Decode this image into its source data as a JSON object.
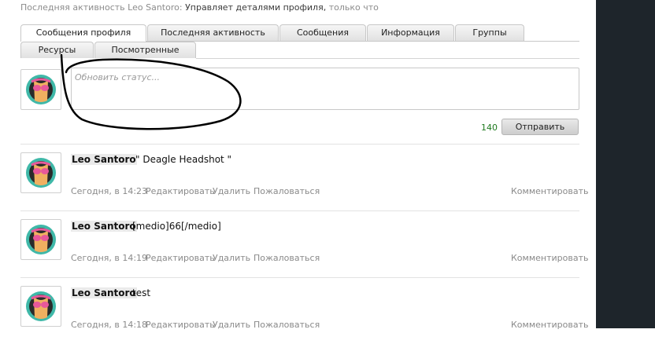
{
  "activity": {
    "prefix": "Последняя активность",
    "user": "Leo Santoro:",
    "action": "Управляет деталями профиля,",
    "time": "только что"
  },
  "tabs_row1": [
    "Сообщения профиля",
    "Последняя активность",
    "Сообщения",
    "Информация",
    "Группы"
  ],
  "tabs_row2": [
    "Ресурсы",
    "Посмотренные"
  ],
  "status": {
    "placeholder": "Обновить статус...",
    "counter": "140",
    "submit_label": "Отправить"
  },
  "posts": [
    {
      "author": "Leo Santoro",
      "message": "\" Deagle Headshot \"",
      "time": "Сегодня, в 14:23",
      "edit": "Редактировать",
      "delete": "Удалить",
      "report": "Пожаловаться",
      "comment": "Комментировать"
    },
    {
      "author": "Leo Santoro",
      "message": "[medio]66[/medio]",
      "time": "Сегодня, в 14:19",
      "edit": "Редактировать",
      "delete": "Удалить",
      "report": "Пожаловаться",
      "comment": "Комментировать"
    },
    {
      "author": "Leo Santoro",
      "message": "test",
      "time": "Сегодня, в 14:18",
      "edit": "Редактировать",
      "delete": "Удалить",
      "report": "Пожаловаться",
      "comment": "Комментировать"
    }
  ],
  "colors": {
    "panel_dark": "#1e252b",
    "counter_green": "#1f7a1f",
    "meta_gray": "#8a8a8a",
    "avatar_skin": "#f0b060",
    "avatar_pink": "#e8589a",
    "avatar_teal": "#3fb8a8"
  }
}
